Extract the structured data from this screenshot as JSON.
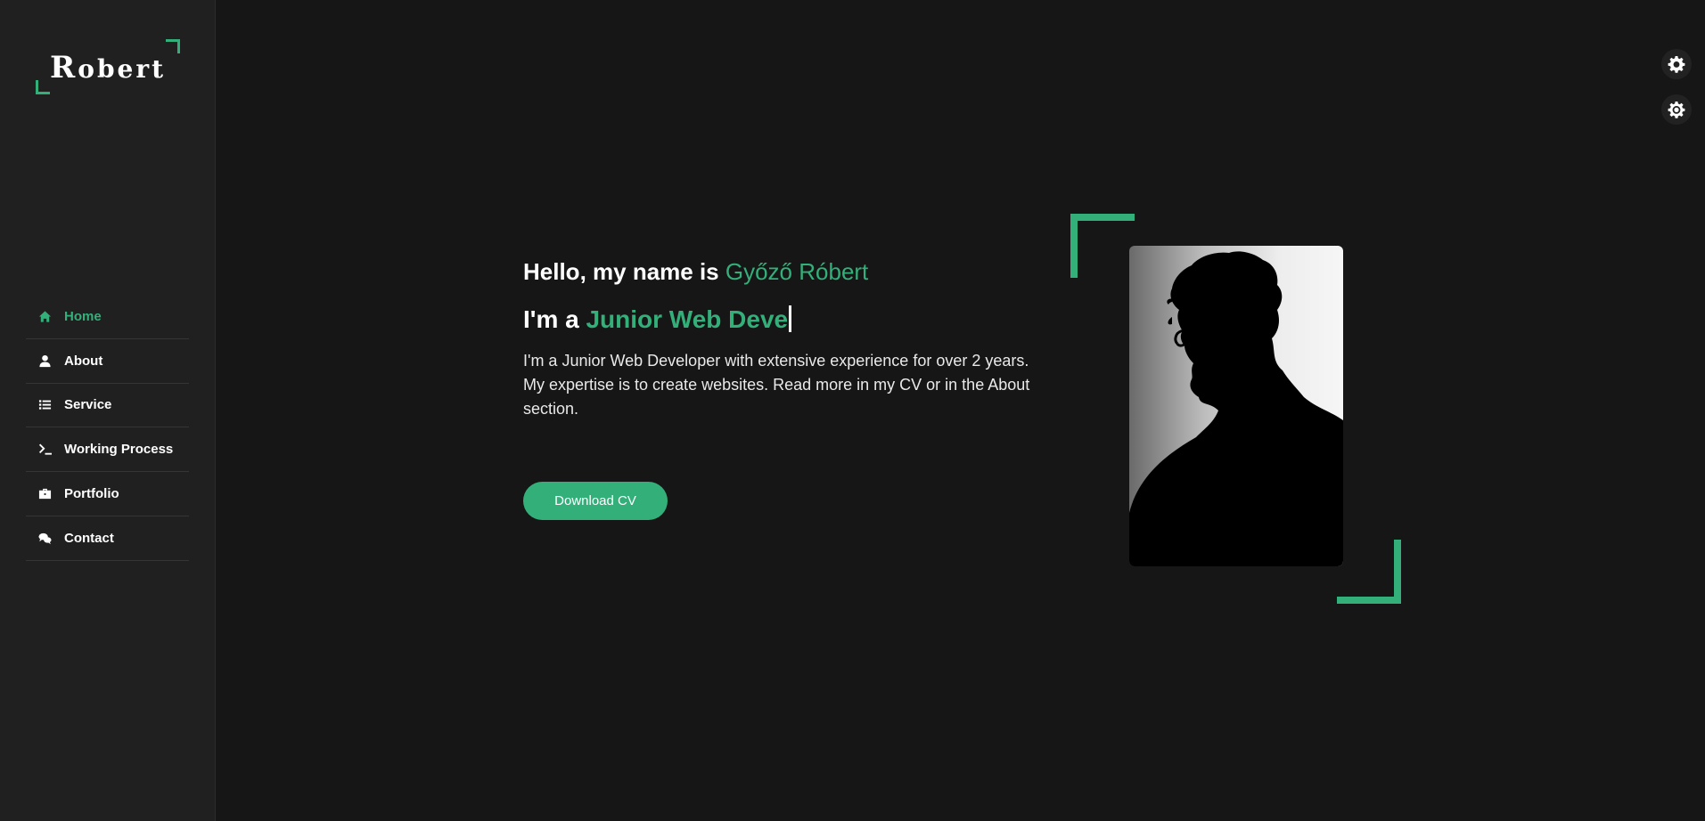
{
  "sidebar": {
    "logo": {
      "first_letter": "R",
      "rest": "obert"
    },
    "items": [
      {
        "label": "Home",
        "icon": "home-icon",
        "active": true
      },
      {
        "label": "About",
        "icon": "user-icon",
        "active": false
      },
      {
        "label": "Service",
        "icon": "list-icon",
        "active": false
      },
      {
        "label": "Working Process",
        "icon": "terminal-icon",
        "active": false
      },
      {
        "label": "Portfolio",
        "icon": "briefcase-icon",
        "active": false
      },
      {
        "label": "Contact",
        "icon": "comments-icon",
        "active": false
      }
    ]
  },
  "hero": {
    "greeting": "Hello, my name is ",
    "name": "Győző Róbert",
    "role_prefix": "I'm a ",
    "role_typed": "Junior Web Deve",
    "description": "I'm a Junior Web Developer with extensive experience for over 2 years. My expertise is to create websites. Read more in my CV or in the About section.",
    "button_label": "Download CV"
  },
  "colors": {
    "accent": "#33b07a",
    "background": "#161616",
    "sidebar": "#202020"
  },
  "settings": [
    {
      "icon": "gear-icon"
    },
    {
      "icon": "sun-gear-icon"
    }
  ]
}
